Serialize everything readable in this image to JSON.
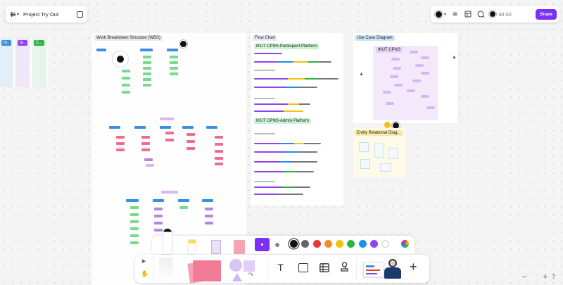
{
  "header": {
    "project_title": "Project Try Out",
    "timer": "30:00",
    "share_label": "Share",
    "menu_icon": "layers-icon",
    "copy_icon": "duplicate-icon"
  },
  "left_tags": [
    "In..",
    "In..",
    "C..."
  ],
  "frames": {
    "wbs": "Work Breakdown Structure (WBS)",
    "flowchart": "Flow Chart",
    "flow_sub1": "IKUT CPNS-Participant Platform",
    "flow_sub2": "IKUT CPNS-Admin Platform",
    "usecase": "Use Case Diagram",
    "usecase_title": "IKUT CPNS",
    "erd": "Entity Relational Diag..."
  },
  "colors": {
    "accent": "#7b2ff7",
    "palette": [
      "#111111",
      "#666666",
      "#e53935",
      "#f28c28",
      "#f4c20d",
      "#2fb344",
      "#1e90e6",
      "#8e44ec",
      "#ffffff"
    ]
  },
  "dock": {
    "text_tool": "T",
    "plus": "+"
  },
  "zoom": {
    "minus": "−",
    "plus": "+",
    "help": "?"
  }
}
